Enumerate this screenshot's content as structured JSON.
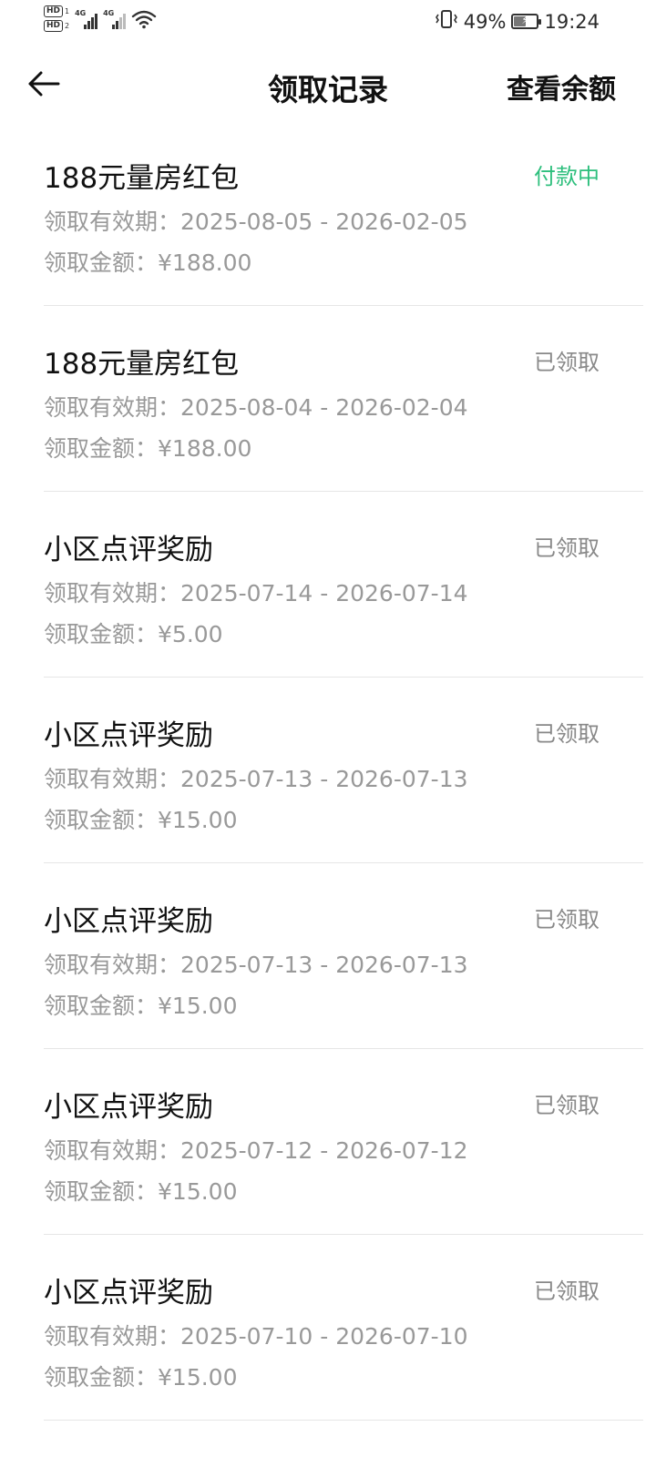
{
  "status_bar": {
    "sim1_badge": "HD",
    "sim1_slot": "1",
    "sim2_badge": "HD",
    "sim2_slot": "2",
    "network1": "4G",
    "network2": "4G",
    "battery_percent": "49%",
    "battery_level": 0.49,
    "time": "19:24",
    "icons": [
      "hd-icon",
      "signal-icon",
      "wifi-icon",
      "vibrate-icon",
      "battery-charging-icon"
    ]
  },
  "header": {
    "back_icon": "arrow-left-icon",
    "title": "领取记录",
    "action": "查看余额"
  },
  "colors": {
    "pending": "#2ebf7d",
    "received": "#888888"
  },
  "records": [
    {
      "name": "188元量房红包",
      "status": "付款中",
      "validity_label": "领取有效期：",
      "validity": "2025-08-05 - 2026-02-05",
      "amount_label": "领取金额：",
      "amount": "¥188.00"
    },
    {
      "name": "188元量房红包",
      "status": "已领取",
      "validity_label": "领取有效期：",
      "validity": "2025-08-04 - 2026-02-04",
      "amount_label": "领取金额：",
      "amount": "¥188.00"
    },
    {
      "name": "小区点评奖励",
      "status": "已领取",
      "validity_label": "领取有效期：",
      "validity": "2025-07-14 - 2026-07-14",
      "amount_label": "领取金额：",
      "amount": "¥5.00"
    },
    {
      "name": "小区点评奖励",
      "status": "已领取",
      "validity_label": "领取有效期：",
      "validity": "2025-07-13 - 2026-07-13",
      "amount_label": "领取金额：",
      "amount": "¥15.00"
    },
    {
      "name": "小区点评奖励",
      "status": "已领取",
      "validity_label": "领取有效期：",
      "validity": "2025-07-13 - 2026-07-13",
      "amount_label": "领取金额：",
      "amount": "¥15.00"
    },
    {
      "name": "小区点评奖励",
      "status": "已领取",
      "validity_label": "领取有效期：",
      "validity": "2025-07-12 - 2026-07-12",
      "amount_label": "领取金额：",
      "amount": "¥15.00"
    },
    {
      "name": "小区点评奖励",
      "status": "已领取",
      "validity_label": "领取有效期：",
      "validity": "2025-07-10 - 2026-07-10",
      "amount_label": "领取金额：",
      "amount": "¥15.00"
    }
  ]
}
